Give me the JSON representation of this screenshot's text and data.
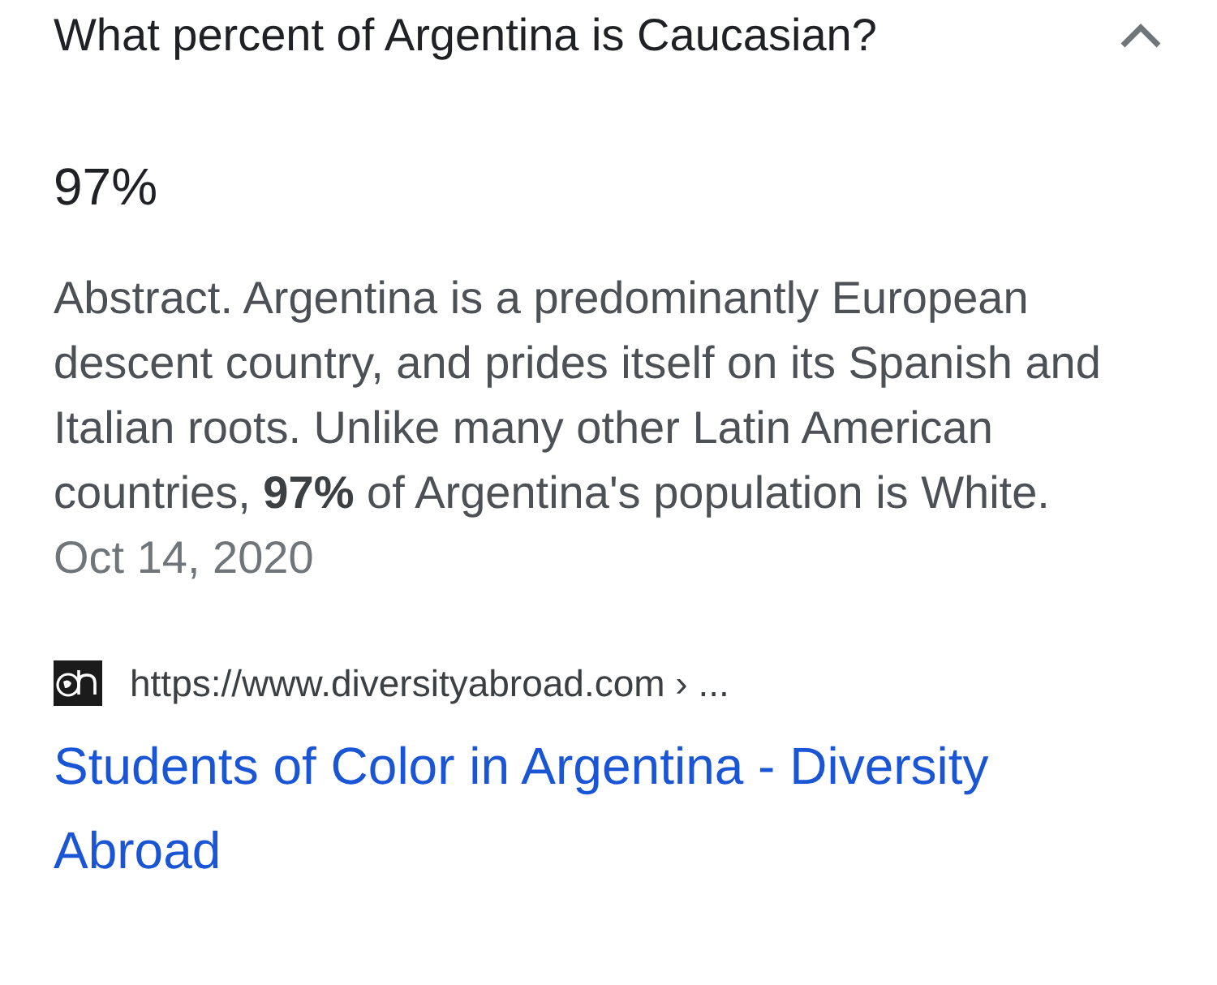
{
  "question": {
    "text": "What percent of Argentina is Caucasian?",
    "expanded": true
  },
  "answer": "97%",
  "snippet": "Abstract. Argentina is a predominantly European descent country, and prides itself on its Spanish and Italian roots. Unlike many other Latin American countries, **97%** of Argentina's population is White.",
  "date": "Oct 14, 2020",
  "source": {
    "url": "https://www.diversityabroad.com › ...",
    "title": "Students of Color in Argentina - Diversity Abroad"
  }
}
